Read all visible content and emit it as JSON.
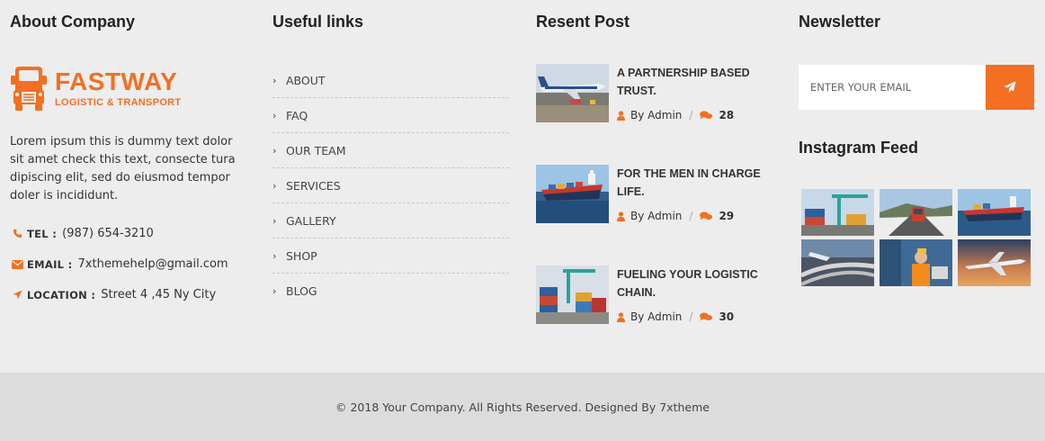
{
  "about": {
    "heading": "About Company",
    "logo_name": "FASTWAY",
    "logo_tagline": "LOGISTIC & TRANSPORT",
    "description": "Lorem ipsum this is dummy text dolor sit amet check this text, consecte tura dipiscing elit, sed do eiusmod tempor doler is incididunt.",
    "contacts": [
      {
        "icon": "phone-icon",
        "label": "TEL :",
        "value": "(987) 654-3210"
      },
      {
        "icon": "envelope-icon",
        "label": "EMAIL :",
        "value": "7xthemehelp@gmail.com"
      },
      {
        "icon": "location-arrow-icon",
        "label": "LOCATION :",
        "value": "Street 4 ,45 Ny City"
      }
    ]
  },
  "links": {
    "heading": "Useful links",
    "items": [
      "ABOUT",
      "FAQ",
      "OUR TEAM",
      "SERVICES",
      "GALLERY",
      "SHOP",
      "BLOG"
    ]
  },
  "posts": {
    "heading": "Resent Post",
    "items": [
      {
        "title": "A PARTNERSHIP BASED TRUST.",
        "author": "By Admin",
        "comments": "28",
        "thumb": "airplane"
      },
      {
        "title": "FOR THE MEN IN CHARGE LIFE.",
        "author": "By Admin",
        "comments": "29",
        "thumb": "ship"
      },
      {
        "title": "FUELING YOUR LOGISTIC CHAIN.",
        "author": "By Admin",
        "comments": "30",
        "thumb": "containers"
      }
    ]
  },
  "newsletter": {
    "heading": "Newsletter",
    "placeholder": "ENTER YOUR EMAIL",
    "submit_icon": "paper-plane-icon"
  },
  "instagram": {
    "heading": "Instagram Feed",
    "images": [
      "crane-containers",
      "truck-road",
      "cargo-ship",
      "highway",
      "warehouse-worker",
      "airplane-sky"
    ]
  },
  "footer": {
    "copyright": "© 2018 Your Company. All Rights Reserved. Designed By 7xtheme"
  },
  "colors": {
    "accent": "#f36f21",
    "background": "#ededed",
    "bottom_bar": "#dcdcdc"
  }
}
